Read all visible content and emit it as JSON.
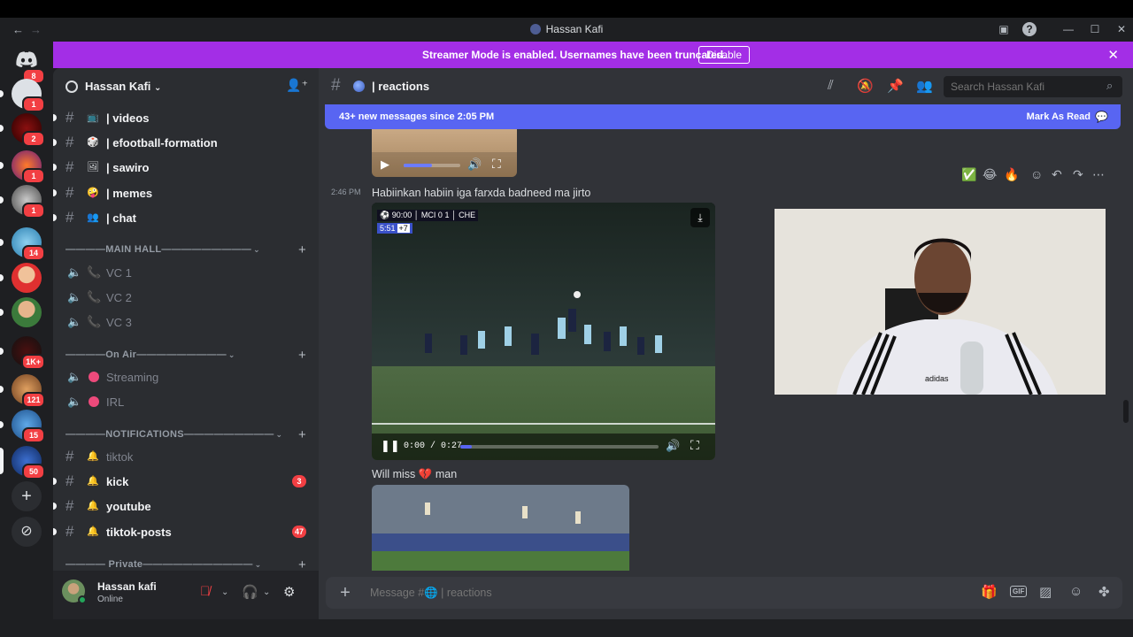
{
  "window": {
    "title": "Hassan Kafi"
  },
  "banner": {
    "message": "Streamer Mode is enabled. Usernames have been truncated.",
    "disable_label": "Disable"
  },
  "rail": {
    "servers": [
      {
        "badge": "8"
      },
      {
        "badge": "1"
      },
      {
        "badge": "2"
      },
      {
        "badge": "1"
      },
      {
        "badge": "1"
      },
      {
        "badge": "14"
      },
      {
        "badge": ""
      },
      {
        "badge": ""
      },
      {
        "badge": "1K+"
      },
      {
        "badge": "121"
      },
      {
        "badge": "15"
      },
      {
        "badge": "50"
      }
    ]
  },
  "guild": {
    "name": "Hassan Kafi"
  },
  "channels": {
    "top": [
      {
        "emoji": "📺",
        "name": "| videos"
      },
      {
        "emoji": "🎲",
        "name": "| efootball-formation"
      },
      {
        "emoji": "🖼",
        "name": "| sawiro"
      },
      {
        "emoji": "🤪",
        "name": "| memes"
      },
      {
        "emoji": "👥",
        "name": "| chat"
      }
    ],
    "main_hall": {
      "label": "————MAIN HALL—————————",
      "items": [
        "VC 1",
        "VC 2",
        "VC 3"
      ]
    },
    "on_air": {
      "label": "————On Air—————————",
      "items": [
        "Streaming",
        "IRL"
      ]
    },
    "notifications": {
      "label": "————NOTIFICATIONS—————————",
      "items": [
        {
          "name": "tiktok",
          "count": ""
        },
        {
          "name": "kick",
          "count": "3"
        },
        {
          "name": "youtube",
          "count": ""
        },
        {
          "name": "tiktok-posts",
          "count": "47"
        }
      ]
    },
    "private": {
      "label": "———— Private———————————"
    }
  },
  "user": {
    "name": "Hassan kafi",
    "status": "Online"
  },
  "channel": {
    "name": "| reactions",
    "search_placeholder": "Search Hassan Kafi"
  },
  "new_messages": {
    "text": "43+ new messages since 2:05 PM",
    "action": "Mark As Read"
  },
  "messages": [
    {
      "time": "2:46 PM",
      "text": "Habiinkan habiin iga farxda badneed ma jirto",
      "video": {
        "score_time": "90:00",
        "home": "MCI",
        "home_score": "0",
        "away_score": "1",
        "away": "CHE",
        "added_time": "5:51",
        "added": "+7",
        "time": "0:00 / 0:27",
        "progress": 0.06
      }
    },
    {
      "text_before": "Will miss",
      "emoji": "💔",
      "text_after": "man"
    }
  ],
  "hover_reactions": [
    "✅",
    "😂",
    "🔥"
  ],
  "composer": {
    "placeholder": "Message #🌐 | reactions"
  },
  "colors": {
    "accent": "#5865f2",
    "banner": "#a32ee6",
    "badge": "#f23f43",
    "online": "#23a55a"
  }
}
